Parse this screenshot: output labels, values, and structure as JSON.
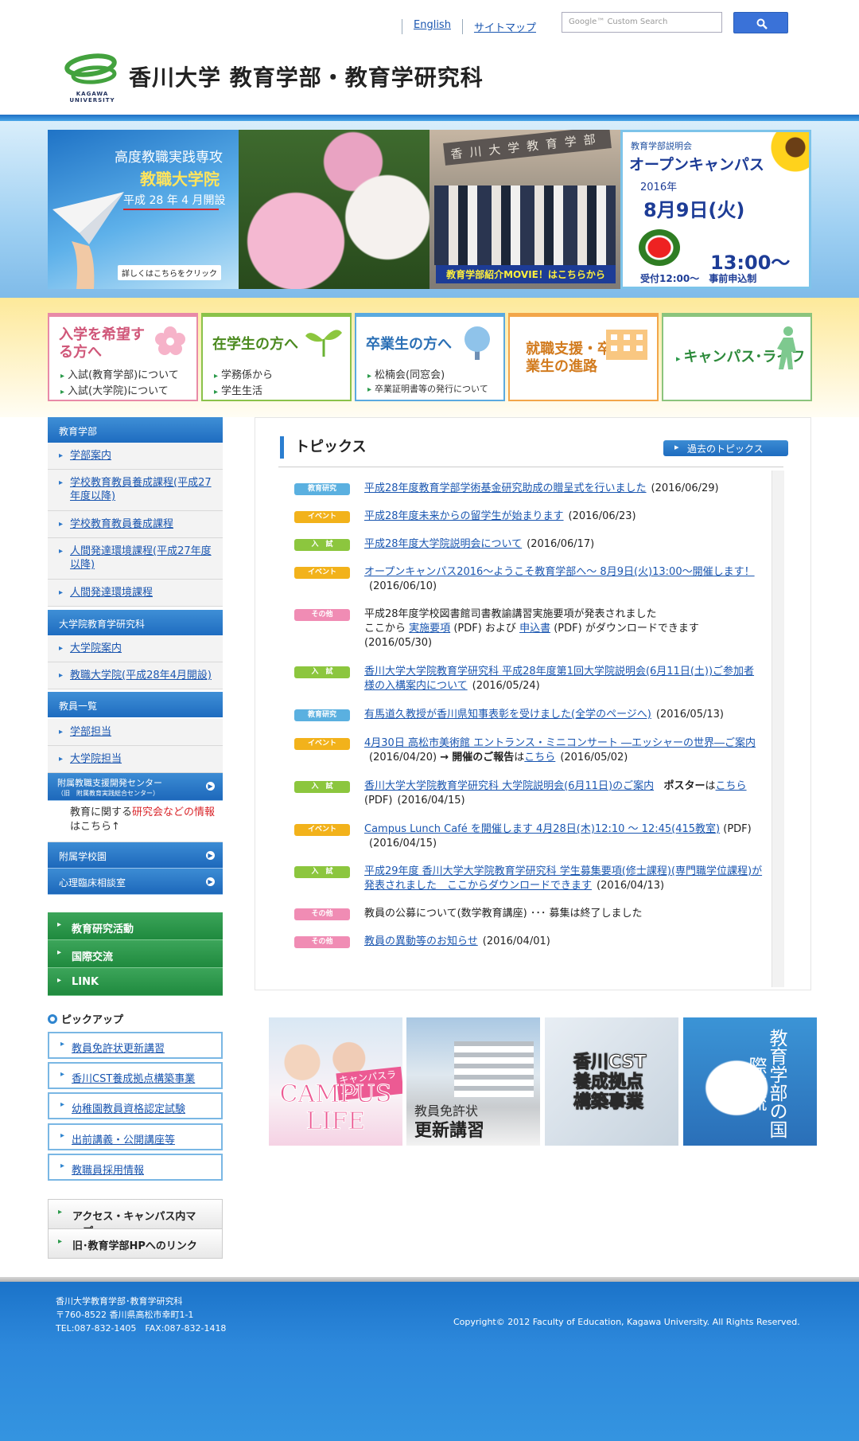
{
  "header": {
    "links": [
      "English",
      "サイトマップ"
    ],
    "search_placeholder": "Google™ Custom Search",
    "logo_text": "KAGAWA UNIVERSITY",
    "title": "香川大学 教育学部・教育学研究科"
  },
  "banners": {
    "b1": {
      "line1": "高度教職実践専攻",
      "line2": "教職大学院",
      "line3": "平成 28 年 4 月開設",
      "link": "詳しくはこちらをクリック"
    },
    "b3": {
      "sign": "香川大学教育学部",
      "caption": "教育学部紹介MOVIE！はこちらから"
    },
    "b4": {
      "line1": "教育学部説明会",
      "line2": "オープンキャンパス",
      "year": "2016年",
      "date": "8月9日(火)",
      "time": "13:00〜",
      "note": "受付12:00〜　事前申込制"
    }
  },
  "nav_tiles": [
    {
      "title": "入学を希望する方へ",
      "subs": [
        "入試(教育学部)について",
        "入試(大学院)について"
      ]
    },
    {
      "title": "在学生の方へ",
      "subs": [
        "学務係から",
        "学生生活"
      ]
    },
    {
      "title": "卒業生の方へ",
      "subs": [
        "松楠会(同窓会)",
        "卒業証明書等の発行について"
      ]
    },
    {
      "title": "就職支援・卒業生の進路",
      "subs": []
    },
    {
      "title": "キャンパス･ライフ",
      "subs": []
    }
  ],
  "sidebar": {
    "head1": "教育学部",
    "items1": [
      "学部案内",
      "学校教育教員養成課程(平成27年度以降)",
      "学校教育教員養成課程",
      "人間発達環境課程(平成27年度以降)",
      "人間発達環境課程"
    ],
    "head2": "大学院教育学研究科",
    "items2": [
      "大学院案内",
      "教職大学院(平成28年4月開設)"
    ],
    "head3": "教員一覧",
    "items3": [
      "学部担当",
      "大学院担当"
    ],
    "center": {
      "line1": "附属教職支援開発センター",
      "line2": "（旧　附属教育実践総合センター）"
    },
    "research_note": {
      "pre": "教育に関する",
      "red": "研究会などの情報",
      "post": "はこちら↑"
    },
    "blue_items": [
      "附属学校園",
      "心理臨床相談室"
    ],
    "green_items": [
      "教育研究活動",
      "国際交流",
      "LINK"
    ],
    "pickup_title": "ピックアップ",
    "pickups": [
      "教員免許状更新講習",
      "香川CST養成拠点構築事業",
      "幼稚園教員資格認定試験",
      "出前講義・公開講座等",
      "教職員採用情報"
    ],
    "gray_items": [
      "アクセス・キャンパス内マップ",
      "旧･教育学部HPへのリンク"
    ]
  },
  "topics": {
    "title": "トピックス",
    "past_button": "過去のトピックス",
    "items": [
      {
        "badge": "教育研究",
        "link": "平成28年度教育学部学術基金研究助成の贈呈式を行いました",
        "date": "(2016/06/29)"
      },
      {
        "badge": "イベント",
        "link": "平成28年度未来からの留学生が始まります",
        "date": "(2016/06/23)"
      },
      {
        "badge": "入　試",
        "link": "平成28年度大学院説明会について",
        "date": "(2016/06/17)"
      },
      {
        "badge": "イベント",
        "link": "オープンキャンパス2016〜ようこそ教育学部へ〜 8月9日(火)13:00〜開催します！",
        "date": "(2016/06/10)"
      },
      {
        "badge": "その他",
        "text1": "平成28年度学校図書館司書教諭講習実施要項が発表されました",
        "text2": "ここから",
        "link_a": "実施要項",
        "text3": "(PDF) および",
        "link_b": "申込書",
        "text4": "(PDF) がダウンロードできます",
        "date": "(2016/05/30)"
      },
      {
        "badge": "入　試",
        "link": "香川大学大学院教育学研究科 平成28年度第1回大学院説明会(6月11日(土))ご参加者様の入構案内について",
        "date": "(2016/05/24)"
      },
      {
        "badge": "教育研究",
        "link": "有馬道久教授が香川県知事表彰を受けました(全学のページへ)",
        "date": "(2016/05/13)"
      },
      {
        "badge": "イベント",
        "link": "4月30日 高松市美術館 エントランス・ミニコンサート ―エッシャーの世界―ご案内",
        "date": "(2016/04/20)",
        "arrow": "→",
        "report_pre": "開催のご報告",
        "report_mid": "は",
        "report_link": "こちら",
        "report_date": "(2016/05/02)"
      },
      {
        "badge": "入　試",
        "link": "香川大学大学院教育学研究科 大学院説明会(6月11日)のご案内",
        "poster": "ポスター",
        "poster_ha": "は",
        "poster_link": "こちら",
        "poster_pdf": "(PDF)",
        "date": "(2016/04/15)"
      },
      {
        "badge": "イベント",
        "link": "Campus Lunch Café を開催します 4月28日(木)12:10 〜 12:45(415教室)",
        "pdf": "(PDF)",
        "date": "(2016/04/15)"
      },
      {
        "badge": "入　試",
        "link": "平成29年度 香川大学大学院教育学研究科 学生募集要項(修士課程)(専門職学位課程)が発表されました　ここからダウンロードできます",
        "date": "(2016/04/13)"
      },
      {
        "badge": "その他",
        "text": "教員の公募について(数学教育講座) ･･･ 募集は終了しました"
      },
      {
        "badge": "その他",
        "link": "教員の異動等のお知らせ",
        "date": "(2016/04/01)"
      }
    ]
  },
  "badge_colors": {
    "教育研究": "#5ab0e0",
    "イベント": "#f2b21b",
    "入　試": "#8cc63e",
    "その他": "#f08cb4"
  },
  "photo_banners": {
    "campus": {
      "tag": "キャンパスライフ",
      "text": "CAMPUS LIFE"
    },
    "license": {
      "line1": "教員免許状",
      "line2": "更新講習"
    },
    "cst": {
      "text": "香川CST養成拠点構築事業"
    },
    "intl": {
      "text": "教育学部の国際交流"
    }
  },
  "footer": {
    "line1": "香川大学教育学部･教育学研究科",
    "line2": "〒760-8522 香川県高松市幸町1-1",
    "line3": "TEL:087-832-1405　FAX:087-832-1418",
    "copyright": "Copyright© 2012 Faculty of Education, Kagawa University. All Rights Reserved."
  }
}
